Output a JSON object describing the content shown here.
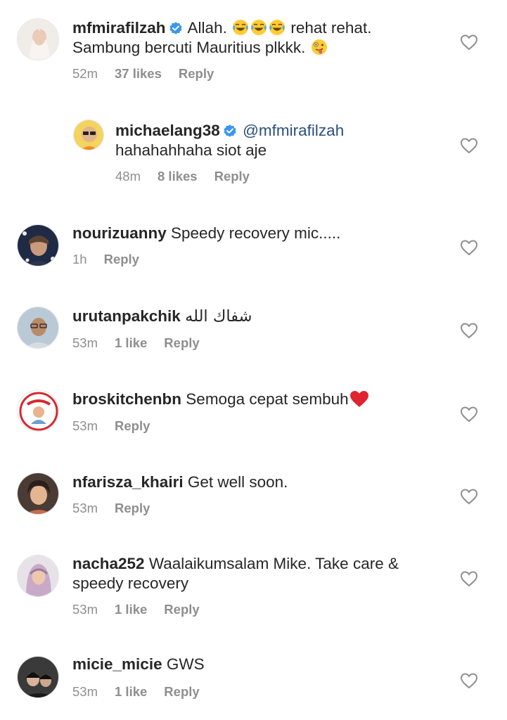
{
  "colors": {
    "text": "#262626",
    "meta": "#8e8e8e",
    "mention": "#2a4f7f",
    "verified": "#3897f0",
    "heart_outline": "#8e8e8e",
    "emoji_heart": "#e0242f"
  },
  "comments": [
    {
      "username": "mfmirafilzah",
      "verified": true,
      "text_parts": [
        "Allah.",
        "rehat rehat."
      ],
      "line2": "Sambung bercuti Mauritius plkkk.",
      "emojis": [
        "joy-emoji",
        "joy-emoji",
        "joy-emoji",
        "zany-face-emoji"
      ],
      "time": "52m",
      "likes": "37 likes",
      "reply": "Reply"
    },
    {
      "username": "michaelang38",
      "verified": true,
      "mention": "@mfmirafilzah",
      "line2": "hahahahhaha siot aje",
      "time": "48m",
      "likes": "8 likes",
      "reply": "Reply"
    },
    {
      "username": "nourizuanny",
      "text": "Speedy recovery mic.....",
      "time": "1h",
      "reply": "Reply"
    },
    {
      "username": "urutanpakchik",
      "text": "شفاك الله",
      "time": "53m",
      "likes": "1 like",
      "reply": "Reply"
    },
    {
      "username": "broskitchenbn",
      "text": "Semoga cepat sembuh",
      "emoji": "red-heart-emoji",
      "time": "53m",
      "reply": "Reply"
    },
    {
      "username": "nfarisza_khairi",
      "text": "Get well soon.",
      "time": "53m",
      "reply": "Reply"
    },
    {
      "username": "nacha252",
      "text": "Waalaikumsalam Mike. Take care &",
      "line2": "speedy recovery",
      "time": "53m",
      "likes": "1 like",
      "reply": "Reply"
    },
    {
      "username": "micie_micie",
      "text": "GWS",
      "time": "53m",
      "likes": "1 like",
      "reply": "Reply"
    }
  ]
}
